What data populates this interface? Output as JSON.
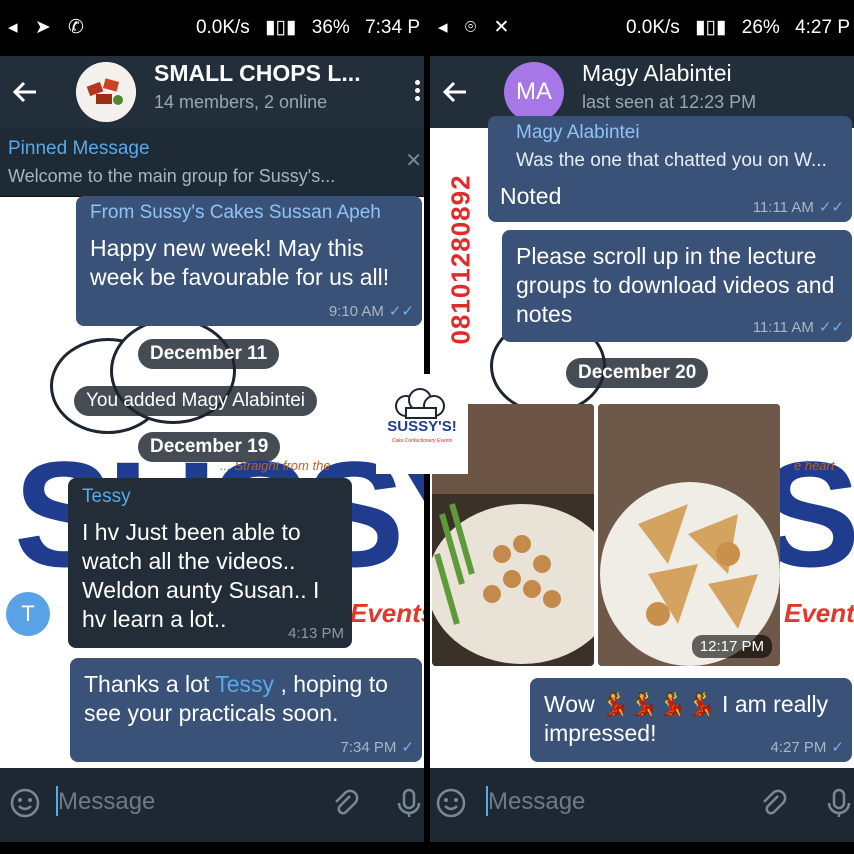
{
  "left": {
    "status": {
      "speed": "0.0K/s",
      "battery": "36%",
      "time": "7:34 P"
    },
    "header": {
      "title": "SMALL CHOPS L...",
      "subtitle": "14 members, 2 online"
    },
    "pinned": {
      "label": "Pinned Message",
      "preview": "Welcome to the main group for Sussy's..."
    },
    "messages": {
      "forward_from": "From Sussy's Cakes Sussan Apeh",
      "forward_text": "Happy new week!  May this week be favourable for us all!",
      "forward_time": "9:10 AM",
      "date1": "December 11",
      "service": "You added Magy Alabintei",
      "date2": "December 19",
      "tessy_name": "Tessy",
      "tessy_text": "I hv Just been able to watch all the videos.. Weldon aunty Susan.. I hv learn a lot..",
      "tessy_time": "4:13 PM",
      "tessy_avatar": "T",
      "reply_pre": "Thanks a lot ",
      "reply_mention": "Tessy",
      "reply_post": " , hoping to see your practicals soon.",
      "reply_time": "7:34 PM"
    },
    "composer_placeholder": "Message"
  },
  "right": {
    "status": {
      "speed": "0.0K/s",
      "battery": "26%",
      "time": "4:27 P"
    },
    "header": {
      "avatar_initials": "MA",
      "title": "Magy Alabintei",
      "subtitle": "last seen at 12:23 PM"
    },
    "messages": {
      "quote_name": "Magy Alabintei",
      "quote_text": "Was the one that chatted you on W...",
      "noted_text": "Noted",
      "noted_time": "11:11 AM",
      "scroll_text": "Please scroll up in the lecture groups to download videos and notes",
      "scroll_time": "11:11 AM",
      "date": "December 20",
      "photo_time": "12:17 PM",
      "wow_pre": "Wow ",
      "wow_post": " I am really impressed!",
      "wow_time": "4:27 PM"
    },
    "composer_placeholder": "Message"
  },
  "overlay": {
    "phone_number": "08101280892",
    "logo_text": "SUSSY'S!",
    "logo_tagline": "Cake  Confectionery  Events"
  },
  "watermark": {
    "brand": "SUSSY'S",
    "tag1": "... Straight from the",
    "tag2": "e heart",
    "word1": "Events",
    "word2": "Events"
  },
  "colors": {
    "bubble_out": "#3b5278",
    "bubble_in": "#222d38",
    "accent": "#5aa9e8",
    "brand_red": "#e02b2b"
  }
}
